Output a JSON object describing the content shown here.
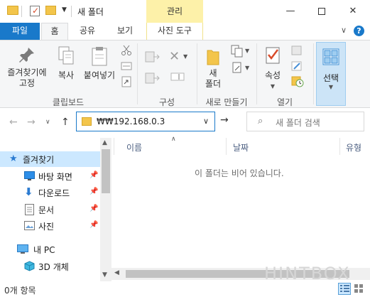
{
  "window": {
    "title": "새 폴더",
    "context_tab_header": "관리",
    "controls": {
      "minimize": "—",
      "maximize": "",
      "close": "✕"
    }
  },
  "tabs": {
    "file": "파일",
    "home": "홈",
    "share": "공유",
    "view": "보기",
    "picture_tools": "사진 도구"
  },
  "ribbon": {
    "clipboard": {
      "pin_quick_access": "즐겨찾기에\n고정",
      "copy": "복사",
      "paste": "붙여넣기",
      "group_label": "클립보드"
    },
    "organize": {
      "group_label": "구성"
    },
    "new": {
      "new_folder": "새\n폴더",
      "group_label": "새로 만들기"
    },
    "open": {
      "properties": "속성",
      "group_label": "열기"
    },
    "select": {
      "select": "선택"
    }
  },
  "nav": {
    "address": "₩₩192.168.0.3",
    "search_placeholder": "새 폴더 검색"
  },
  "sidebar": {
    "items": [
      {
        "label": "즐겨찾기",
        "selected": true
      },
      {
        "label": "바탕 화면",
        "pinned": true
      },
      {
        "label": "다운로드",
        "pinned": true
      },
      {
        "label": "문서",
        "pinned": true
      },
      {
        "label": "사진",
        "pinned": true
      },
      {
        "label": "내 PC"
      },
      {
        "label": "3D 개체"
      }
    ]
  },
  "content": {
    "columns": [
      "이름",
      "날짜",
      "유형"
    ],
    "empty_message": "이 폴더는 비어 있습니다."
  },
  "status": {
    "item_count": "0개 항목"
  },
  "watermark": "HINTBOX",
  "colors": {
    "accent": "#1979ca",
    "context_tab": "#fdf1a9",
    "selection": "#cce8ff"
  }
}
